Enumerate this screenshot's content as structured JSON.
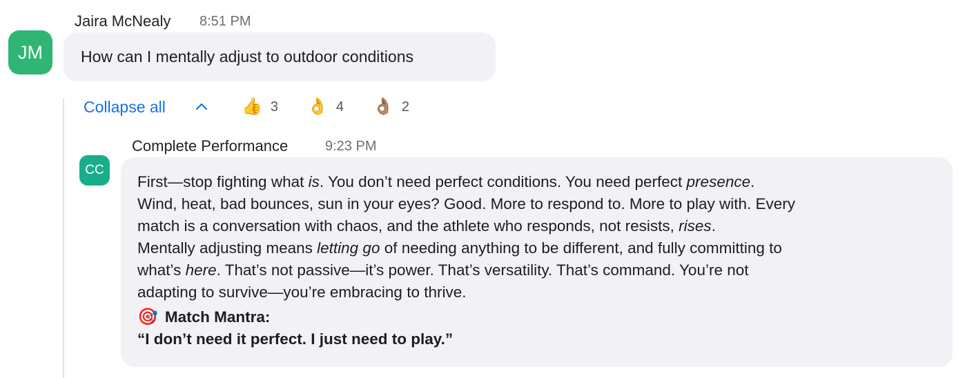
{
  "message1": {
    "sender": "Jaira McNealy",
    "time": "8:51 PM",
    "avatar_initials": "JM",
    "avatar_color": "#2fb674",
    "text": "How can I mentally adjust to outdoor conditions"
  },
  "thread": {
    "collapse_label": "Collapse all",
    "collapse_icon": "chevron-up-icon",
    "link_color": "#1671e6",
    "reactions": [
      {
        "emoji": "👍",
        "icon": "thumbs-up-icon",
        "count": "3"
      },
      {
        "emoji": "👌",
        "icon": "ok-hand-icon",
        "count": "4"
      },
      {
        "emoji": "👌🏽",
        "icon": "ok-hand-medium-skin-icon",
        "count": "2"
      }
    ]
  },
  "message2": {
    "sender": "Complete Performance",
    "time": "9:23 PM",
    "avatar_initials": "CC",
    "avatar_color": "#1aad8b",
    "body": {
      "l1a": "First—stop fighting what ",
      "l1b": "is",
      "l1c": ". You don’t need perfect conditions. You need perfect ",
      "l1d": "presence",
      "l1e": ".",
      "l2": "Wind, heat, bad bounces, sun in your eyes? Good. More to respond to. More to play with. Every",
      "l3a": "match is a conversation with chaos, and the athlete who responds, not resists, ",
      "l3b": "rises",
      "l3c": ".",
      "l4a": "Mentally adjusting means ",
      "l4b": "letting go",
      "l4c": " of needing anything to be different, and fully committing to",
      "l5a": "what’s ",
      "l5b": "here",
      "l5c": ". That’s not passive—it’s power. That’s versatility. That’s command. You’re not",
      "l6": "adapting to survive—you’re embracing to thrive."
    },
    "mantra_emoji": "🎯",
    "mantra_icon": "direct-hit-target-icon",
    "mantra_title": "Match Mantra:",
    "mantra_text": "“I don’t need it perfect. I just need to play.”"
  }
}
